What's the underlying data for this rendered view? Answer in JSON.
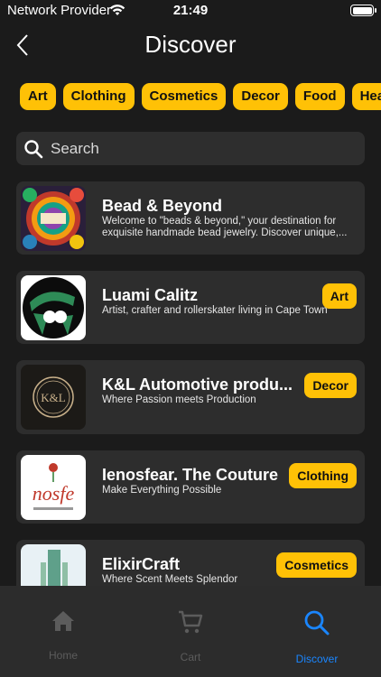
{
  "status": {
    "carrier": "Network Provider",
    "time": "21:49"
  },
  "header": {
    "title": "Discover"
  },
  "categories": [
    "Art",
    "Clothing",
    "Cosmetics",
    "Decor",
    "Food",
    "Hea"
  ],
  "search": {
    "placeholder": "Search"
  },
  "stores": [
    {
      "name": "Bead & Beyond",
      "description": "Welcome to \"beads & beyond,\" your destination for exquisite handmade bead jewelry. Discover unique,...",
      "badge": ""
    },
    {
      "name": "Luami Calitz",
      "description": "Artist, crafter and rollerskater living in Cape Town",
      "badge": "Art"
    },
    {
      "name": "K&L Automotive produ...",
      "description": "Where Passion meets Production",
      "badge": "Decor"
    },
    {
      "name": "Ienosfear. The Couture",
      "description": "Make Everything Possible",
      "badge": "Clothing"
    },
    {
      "name": "ElixirCraft",
      "description": "Where Scent Meets Splendor",
      "badge": "Cosmetics"
    }
  ],
  "thumb_text": {
    "kl": "K&L",
    "nosfe": "nosfe"
  },
  "tabs": [
    {
      "label": "Home",
      "icon": "home-icon"
    },
    {
      "label": "Cart",
      "icon": "cart-icon"
    },
    {
      "label": "Discover",
      "icon": "discover-search-icon"
    }
  ],
  "colors": {
    "accent": "#ffc106",
    "active_tab": "#1a86ff",
    "card": "#2d2d2d",
    "background": "#1b1b1b"
  }
}
